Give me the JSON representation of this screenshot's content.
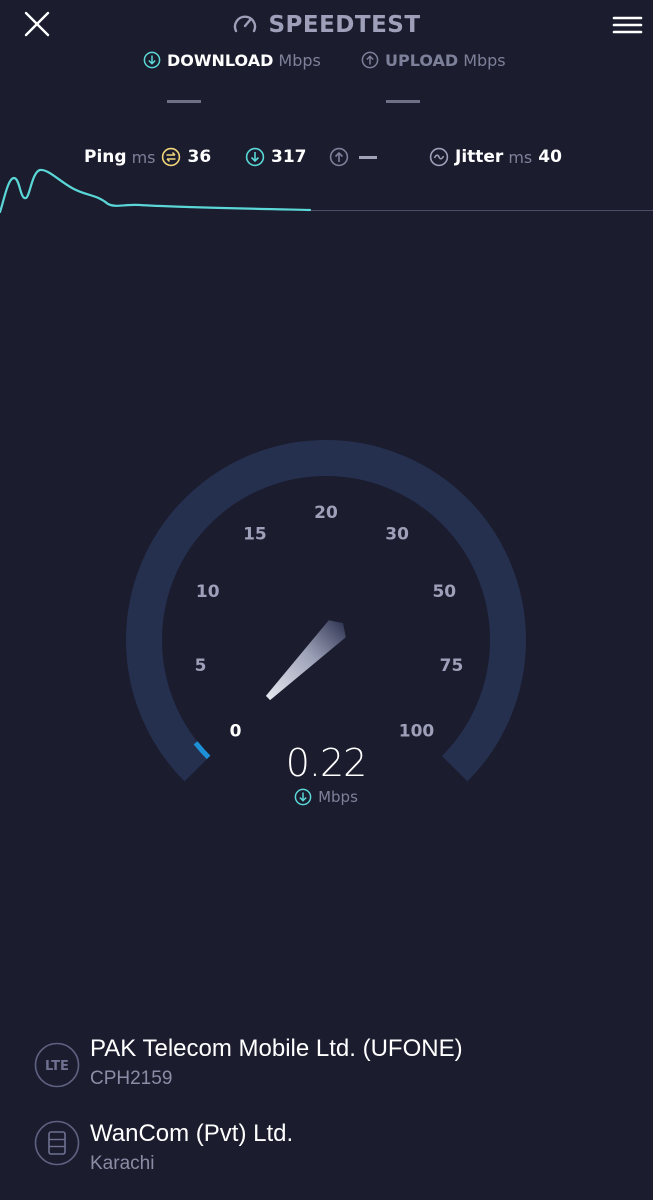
{
  "header": {
    "title": "SPEEDTEST"
  },
  "tabs": {
    "download": {
      "label": "DOWNLOAD",
      "unit": "Mbps"
    },
    "upload": {
      "label": "UPLOAD",
      "unit": "Mbps"
    }
  },
  "metrics": {
    "ping": {
      "label": "Ping",
      "unit": "ms",
      "value": "36"
    },
    "download_value": "317",
    "jitter": {
      "label": "Jitter",
      "unit": "ms",
      "value": "40"
    }
  },
  "gauge": {
    "ticks": [
      "0",
      "5",
      "10",
      "15",
      "20",
      "30",
      "50",
      "75",
      "100"
    ],
    "current_value": "0.22",
    "current_unit": "Mbps",
    "needle_fraction": 0.01
  },
  "providers": [
    {
      "name": "PAK Telecom Mobile Ltd. (UFONE)",
      "sub": "CPH2159",
      "icon": "lte-icon"
    },
    {
      "name": "WanCom (Pvt) Ltd.",
      "sub": "Karachi",
      "icon": "server-icon"
    }
  ],
  "colors": {
    "background": "#1b1c2e",
    "accent": "#5ad7d6",
    "ping": "#f2d67a",
    "arc": "#25304f",
    "arc_active": "#1e90d8"
  }
}
